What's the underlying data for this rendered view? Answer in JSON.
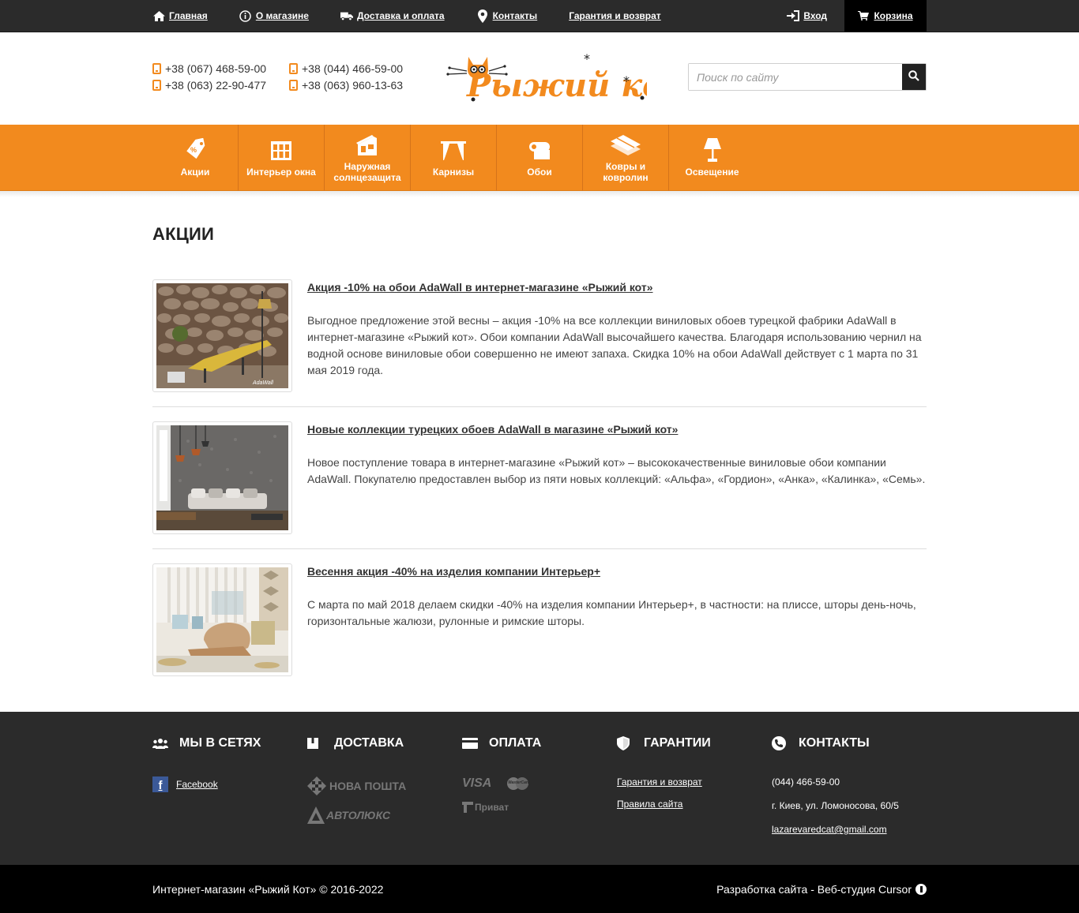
{
  "topbar": {
    "links": [
      {
        "label": "Главная",
        "icon": "home-icon"
      },
      {
        "label": "О магазине",
        "icon": "info-icon"
      },
      {
        "label": "Доставка и оплата",
        "icon": "truck-icon"
      },
      {
        "label": "Контакты",
        "icon": "map-pin-icon"
      },
      {
        "label": "Гарантия и возврат",
        "icon": ""
      }
    ],
    "login_label": "Вход",
    "cart_label": "Корзина"
  },
  "header": {
    "phones": [
      "+38 (067) 468-59-00",
      "+38 (044) 466-59-00",
      "+38 (063) 22-90-477",
      "+38 (063) 960-13-63"
    ],
    "logo_text": "Рыжий кот",
    "search_placeholder": "Поиск по сайту"
  },
  "categories": [
    {
      "label": "Акции",
      "icon": "sale-tag-icon"
    },
    {
      "label": "Интерьер окна",
      "icon": "window-icon"
    },
    {
      "label": "Наружная солнцезащита",
      "icon": "house-shade-icon"
    },
    {
      "label": "Карнизы",
      "icon": "curtain-rod-icon"
    },
    {
      "label": "Обои",
      "icon": "wallpaper-roll-icon"
    },
    {
      "label": "Ковры и ковролин",
      "icon": "carpet-icon"
    },
    {
      "label": "Освещение",
      "icon": "lamp-icon"
    }
  ],
  "page": {
    "title": "АКЦИИ",
    "items": [
      {
        "title": "Акция -10% на обои AdaWall в интернет-магазине «Рыжий кот»",
        "text": "Выгодное предложение этой весны – акция -10% на все коллекции виниловых обоев турецкой фабрики AdaWall в интернет-магазине «Рыжий кот». Обои компании AdaWall высочайшего качества. Благодаря использованию чернил на водной основе виниловые обои совершенно не имеют запаха. Скидка 10% на обои AdaWall действует с 1 марта по 31 мая 2019 года.",
        "image_caption": "AdaWall"
      },
      {
        "title": "Новые коллекции турецких обоев AdaWall в магазине «Рыжий кот»",
        "text": "Новое поступление товара в интернет-магазине «Рыжий кот» – высококачественные виниловые обои компании AdaWall. Покупателю предоставлен выбор из пяти новых коллекций: «Альфа», «Гордион», «Анка», «Калинка», «Семь»."
      },
      {
        "title": "Весення акция -40% на изделия компании Интерьер+",
        "text": "С марта по май 2018 делаем скидки -40% на изделия компании Интерьер+, в частности: на плиссе, шторы день-ночь, горизонтальные жалюзи, рулонные и римские шторы."
      }
    ]
  },
  "footer": {
    "social": {
      "title": "МЫ В СЕТЯХ",
      "facebook_label": "Facebook"
    },
    "delivery": {
      "title": "ДОСТАВКА",
      "carriers": [
        "НОВА ПОШТА",
        "АВТОЛЮКС"
      ]
    },
    "payment": {
      "title": "ОПЛАТА",
      "methods": [
        "VISA",
        "MasterCard",
        "Приват"
      ]
    },
    "guarantee": {
      "title": "ГАРАНТИИ",
      "links": [
        "Гарантия и возврат",
        "Правила сайта"
      ]
    },
    "contacts": {
      "title": "КОНТАКТЫ",
      "phone": "(044) 466-59-00",
      "address": "г. Киев, ул. Ломоносова, 60/5",
      "email": "lazarevaredcat@gmail.com"
    },
    "copyright": "Интернет-магазин «Рыжий Кот» © 2016-2022",
    "developer": "Разработка сайта - Веб-студия Cursor"
  },
  "colors": {
    "accent": "#f28a1e",
    "dark": "#2b2b2b",
    "black": "#000000"
  }
}
